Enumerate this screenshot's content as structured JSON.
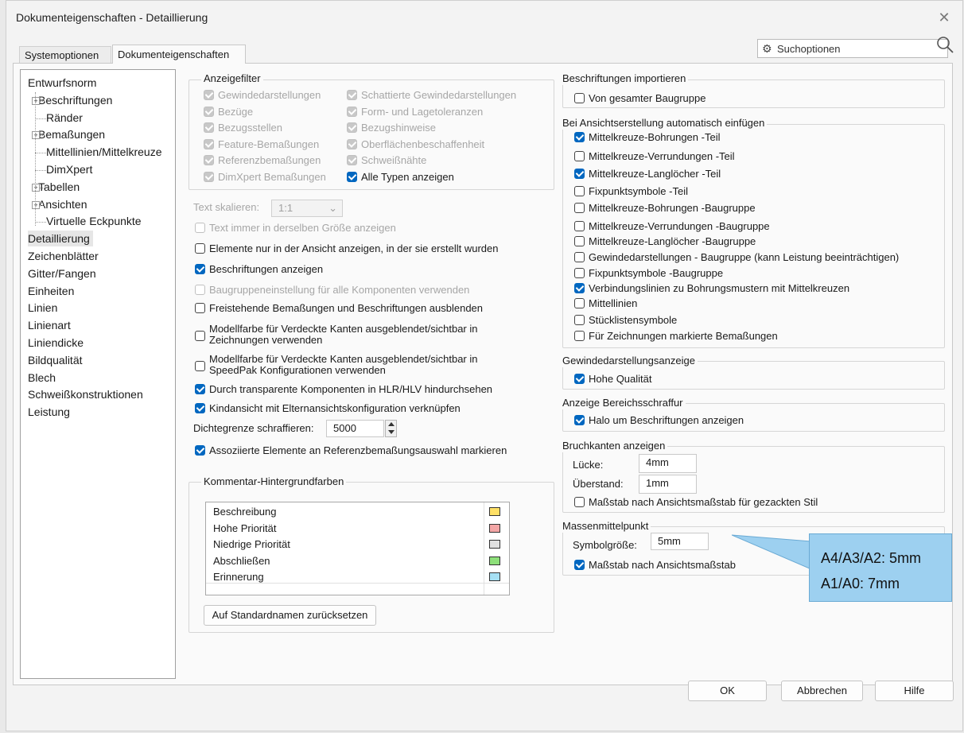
{
  "window": {
    "title": "Dokumenteigenschaften - Detaillierung",
    "close_glyph": "✕"
  },
  "tabs": [
    {
      "label": "Systemoptionen",
      "active": false
    },
    {
      "label": "Dokumenteigenschaften",
      "active": true
    }
  ],
  "search": {
    "placeholder": "Suchoptionen"
  },
  "tree": [
    {
      "label": "Entwurfsnorm",
      "expandable": false
    },
    {
      "label": "Beschriftungen",
      "expandable": true
    },
    {
      "label": "Ränder",
      "expandable": false
    },
    {
      "label": "Bemaßungen",
      "expandable": true
    },
    {
      "label": "Mittellinien/Mittelkreuze",
      "expandable": false
    },
    {
      "label": "DimXpert",
      "expandable": false
    },
    {
      "label": "Tabellen",
      "expandable": true
    },
    {
      "label": "Ansichten",
      "expandable": true
    },
    {
      "label": "Virtuelle Eckpunkte",
      "expandable": false
    },
    {
      "label": "Detaillierung",
      "selected": true
    },
    {
      "label": "Zeichenblätter"
    },
    {
      "label": "Gitter/Fangen"
    },
    {
      "label": "Einheiten"
    },
    {
      "label": "Linien"
    },
    {
      "label": "Linienart"
    },
    {
      "label": "Liniendicke"
    },
    {
      "label": "Bildqualität"
    },
    {
      "label": "Blech"
    },
    {
      "label": "Schweißkonstruktionen"
    },
    {
      "label": "Leistung"
    }
  ],
  "anzeigefilter": {
    "title": "Anzeigefilter",
    "col1": [
      {
        "label": "Gewindedarstellungen",
        "state": "dis"
      },
      {
        "label": "Bezüge",
        "state": "dis"
      },
      {
        "label": "Bezugsstellen",
        "state": "dis"
      },
      {
        "label": "Feature-Bemaßungen",
        "state": "dis"
      },
      {
        "label": "Referenzbemaßungen",
        "state": "dis"
      },
      {
        "label": "DimXpert Bemaßungen",
        "state": "dis"
      }
    ],
    "col2": [
      {
        "label": "Schattierte Gewindedarstellungen",
        "state": "dis"
      },
      {
        "label": "Form- und Lagetoleranzen",
        "state": "dis"
      },
      {
        "label": "Bezugshinweise",
        "state": "dis"
      },
      {
        "label": "Oberflächenbeschaffenheit",
        "state": "dis"
      },
      {
        "label": "Schweißnähte",
        "state": "dis"
      },
      {
        "label": "Alle Typen anzeigen",
        "state": "on"
      }
    ]
  },
  "text_scale": {
    "label": "Text skalieren:",
    "value": "1:1"
  },
  "mid_options": [
    {
      "label": "Text immer in derselben Größe anzeigen",
      "state": "disoff"
    },
    {
      "label": "Elemente nur in der Ansicht anzeigen, in der sie erstellt wurden",
      "state": "off"
    },
    {
      "label": "Beschriftungen anzeigen",
      "state": "on"
    },
    {
      "label": "Baugruppeneinstellung für alle Komponenten verwenden",
      "state": "disoff"
    },
    {
      "label": "Freistehende Bemaßungen und Beschriftungen ausblenden",
      "state": "off"
    }
  ],
  "two_line_options": [
    {
      "line1": "Modellfarbe für Verdeckte Kanten ausgeblendet/sichtbar in",
      "line2": "Zeichnungen verwenden",
      "state": "off"
    },
    {
      "line1": "Modellfarbe für Verdeckte Kanten ausgeblendet/sichtbar in",
      "line2": "SpeedPak Konfigurationen verwenden",
      "state": "off"
    }
  ],
  "more_options": [
    {
      "label": "Durch transparente Komponenten in HLR/HLV hindurchsehen",
      "state": "on"
    },
    {
      "label": "Kindansicht mit Elternansichtskonfiguration verknüpfen",
      "state": "on"
    }
  ],
  "density": {
    "label": "Dichtegrenze schraffieren:",
    "value": "5000"
  },
  "assoc_option": {
    "label": "Assoziierte Elemente an Referenzbemaßungsauswahl markieren",
    "state": "on"
  },
  "kommentar": {
    "title": "Kommentar-Hintergrundfarben",
    "rows": [
      {
        "label": "Beschreibung",
        "color": "#ffe066"
      },
      {
        "label": "Hohe Priorität",
        "color": "#f4a6a6"
      },
      {
        "label": "Niedrige Priorität",
        "color": "#e0e0e0"
      },
      {
        "label": "Abschließen",
        "color": "#8ee07a"
      },
      {
        "label": "Erinnerung",
        "color": "#a6e0f4"
      }
    ],
    "reset_button": "Auf Standardnamen zurücksetzen"
  },
  "import_group": {
    "title": "Beschriftungen importieren",
    "options": [
      {
        "label": "Von gesamter Baugruppe",
        "state": "off"
      }
    ]
  },
  "auto_group": {
    "title": "Bei Ansichtserstellung automatisch einfügen",
    "options": [
      {
        "label": "Mittelkreuze-Bohrungen -Teil",
        "state": "on"
      },
      {
        "label": "Mittelkreuze-Verrundungen -Teil",
        "state": "off"
      },
      {
        "label": "Mittelkreuze-Langlöcher -Teil",
        "state": "on"
      },
      {
        "label": "Fixpunktsymbole -Teil",
        "state": "off"
      },
      {
        "label": "Mittelkreuze-Bohrungen -Baugruppe",
        "state": "off"
      },
      {
        "label": "Mittelkreuze-Verrundungen -Baugruppe",
        "state": "off"
      },
      {
        "label": "Mittelkreuze-Langlöcher -Baugruppe",
        "state": "off"
      },
      {
        "label": "Gewindedarstellungen - Baugruppe (kann Leistung beeinträchtigen)",
        "state": "off"
      },
      {
        "label": "Fixpunktsymbole -Baugruppe",
        "state": "off"
      },
      {
        "label": "Verbindungslinien zu Bohrungsmustern mit Mittelkreuzen",
        "state": "on"
      },
      {
        "label": "Mittellinien",
        "state": "off"
      },
      {
        "label": "Stücklistensymbole",
        "state": "off"
      },
      {
        "label": "Für Zeichnungen markierte Bemaßungen",
        "state": "off"
      }
    ]
  },
  "gewinde_group": {
    "title": "Gewindedarstellungsanzeige",
    "options": [
      {
        "label": "Hohe Qualität",
        "state": "on"
      }
    ]
  },
  "bereich_group": {
    "title": "Anzeige Bereichsschraffur",
    "options": [
      {
        "label": "Halo um Beschriftungen anzeigen",
        "state": "on"
      }
    ]
  },
  "bruch_group": {
    "title": "Bruchkanten anzeigen",
    "gap_label": "Lücke:",
    "gap_value": "4mm",
    "overhang_label": "Überstand:",
    "overhang_value": "1mm",
    "option": {
      "label": "Maßstab nach Ansichtsmaßstab für gezackten Stil",
      "state": "off"
    }
  },
  "massen_group": {
    "title": "Massenmittelpunkt",
    "size_label": "Symbolgröße:",
    "size_value": "5mm",
    "option": {
      "label": "Maßstab nach Ansichtsmaßstab",
      "state": "on"
    }
  },
  "callout": {
    "line1": "A4/A3/A2: 5mm",
    "line2": "A1/A0: 7mm",
    "color": "#9dd0f0"
  },
  "footer": {
    "ok": "OK",
    "cancel": "Abbrechen",
    "help": "Hilfe"
  }
}
